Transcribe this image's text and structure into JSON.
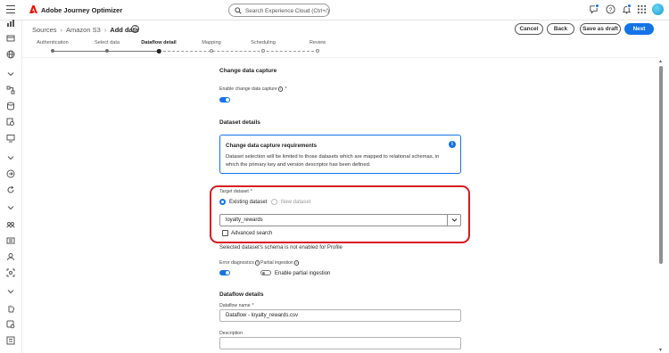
{
  "app": {
    "title": "Adobe Journey Optimizer"
  },
  "search": {
    "placeholder": "Search Experience Cloud (Ctrl+/)"
  },
  "breadcrumb": {
    "items": [
      "Sources",
      "Amazon S3"
    ],
    "current": "Add data"
  },
  "actions": {
    "cancel": "Cancel",
    "back": "Back",
    "save_draft": "Save as draft",
    "next": "Next"
  },
  "steps": [
    {
      "label": "Authentication",
      "state": "done"
    },
    {
      "label": "Select data",
      "state": "done"
    },
    {
      "label": "Dataflow detail",
      "state": "current"
    },
    {
      "label": "Mapping",
      "state": "todo"
    },
    {
      "label": "Scheduling",
      "state": "todo"
    },
    {
      "label": "Review",
      "state": "todo"
    }
  ],
  "cdc": {
    "section_title": "Change data capture",
    "enable_label": "Enable change data capture",
    "enabled": true
  },
  "dataset_details": {
    "section_title": "Dataset details",
    "info_title": "Change data capture requirements",
    "info_body": "Dataset selection will be limited to those datasets which are mapped to relational schemas, in which the primary key and version descriptor has been defined.",
    "target_label": "Target dataset",
    "existing_label": "Existing dataset",
    "new_label": "New dataset",
    "selected_dataset": "loyalty_rewards",
    "advanced_search": "Advanced search",
    "profile_note": "Selected dataset's schema is not enabled for Profile"
  },
  "diagnostics": {
    "error_label": "Error diagnostics",
    "error_enabled": true,
    "partial_label": "Partial ingestion",
    "partial_toggle_label": "Enable partial ingestion",
    "partial_enabled": false
  },
  "dataflow": {
    "section_title": "Dataflow details",
    "name_label": "Dataflow name",
    "name_value": "Dataflow - loyalty_rewards.csv",
    "description_label": "Description",
    "description_value": ""
  },
  "colors": {
    "accent": "#1473e6",
    "highlight": "#d7181f",
    "brand": "#eb1000"
  }
}
